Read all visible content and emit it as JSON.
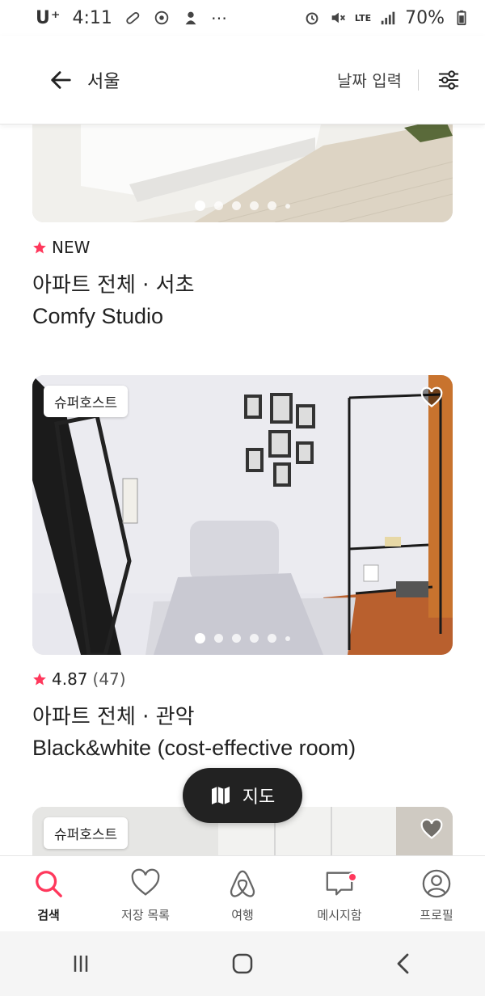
{
  "status_bar": {
    "carrier": "U⁺",
    "time": "4:11",
    "lte": "LTE",
    "battery": "70%"
  },
  "header": {
    "title": "서울",
    "date_placeholder": "날짜 입력"
  },
  "listings": [
    {
      "rating_text": "NEW",
      "rating_count": "",
      "type": "아파트 전체 · 서초",
      "name": "Comfy Studio",
      "badge": "",
      "photo_count": 6,
      "active_photo": 0
    },
    {
      "rating_text": "4.87",
      "rating_count": "(47)",
      "type": "아파트 전체 · 관악",
      "name": "Black&white (cost-effective room)",
      "badge": "슈퍼호스트",
      "photo_count": 6,
      "active_photo": 0
    },
    {
      "rating_text": "",
      "rating_count": "",
      "type": "",
      "name": "",
      "badge": "슈퍼호스트"
    }
  ],
  "map_button": {
    "label": "지도"
  },
  "bottom_nav": [
    {
      "label": "검색",
      "icon": "search-icon",
      "active": true
    },
    {
      "label": "저장 목록",
      "icon": "heart-icon",
      "active": false
    },
    {
      "label": "여행",
      "icon": "airbnb-logo-icon",
      "active": false
    },
    {
      "label": "메시지함",
      "icon": "message-icon",
      "active": false,
      "notification": true
    },
    {
      "label": "프로필",
      "icon": "profile-icon",
      "active": false
    }
  ],
  "colors": {
    "accent": "#ff385c",
    "text": "#222222",
    "map_button_bg": "#222222"
  }
}
